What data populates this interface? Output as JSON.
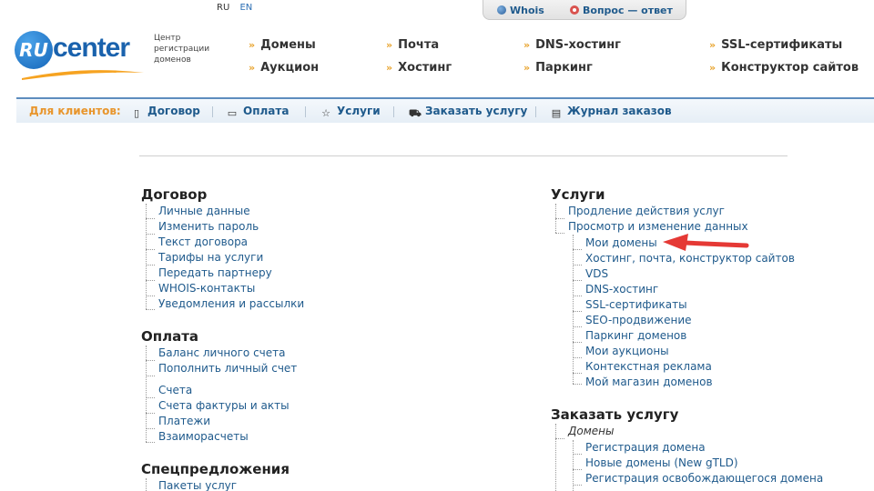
{
  "lang": {
    "ru": "RU",
    "en": "EN"
  },
  "top_tabs": {
    "whois": "Whois",
    "qa": "Вопрос — ответ"
  },
  "logo": {
    "ru": "RU",
    "word": "center",
    "tagline": [
      "Центр",
      "регистрации",
      "доменов"
    ]
  },
  "nav": {
    "items": [
      "Домены",
      "Почта",
      "DNS-хостинг",
      "SSL-сертификаты",
      "Аукцион",
      "Хостинг",
      "Паркинг",
      "Конструктор сайтов"
    ]
  },
  "client_bar": {
    "label": "Для клиентов:",
    "items": [
      "Договор",
      "Оплата",
      "Услуги",
      "Заказать услугу",
      "Журнал заказов"
    ]
  },
  "left": {
    "dogovor": {
      "title": "Договор",
      "items": [
        "Личные данные",
        "Изменить пароль",
        "Текст договора",
        "Тарифы на услуги",
        "Передать партнеру",
        "WHOIS-контакты",
        "Уведомления и рассылки"
      ]
    },
    "oplata": {
      "title": "Оплата",
      "items": [
        "Баланс личного счета",
        "Пополнить личный счет",
        "Счета",
        "Счета фактуры и акты",
        "Платежи",
        "Взаиморасчеты"
      ]
    },
    "spec": {
      "title": "Спецпредложения",
      "items": [
        "Пакеты услуг"
      ]
    }
  },
  "right": {
    "uslugi": {
      "title": "Услуги",
      "items": [
        "Продление действия услуг",
        "Просмотр и изменение данных"
      ],
      "sub": [
        "Мои домены",
        "Хостинг, почта, конструктор сайтов",
        "VDS",
        "DNS-хостинг",
        "SSL-сертификаты",
        "SEO-продвижение",
        "Паркинг доменов",
        "Мои аукционы",
        "Контекстная реклама",
        "Мой магазин доменов"
      ]
    },
    "zakazat": {
      "title": "Заказать услугу",
      "group": "Домены",
      "sub": [
        "Регистрация домена",
        "Новые домены (New gTLD)",
        "Регистрация освобождающегося домена"
      ]
    }
  },
  "colors": {
    "accent": "#1f5a8c",
    "orange": "#e8952c",
    "arrow": "#e53935"
  }
}
